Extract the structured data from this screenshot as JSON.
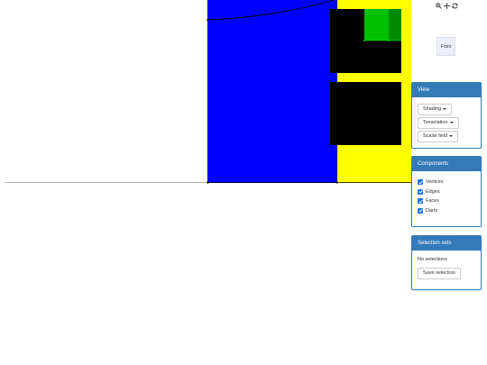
{
  "toolbar": {
    "icons": [
      "zoom-in-icon",
      "move-icon",
      "refresh-icon"
    ]
  },
  "view_cube": {
    "label": "Front"
  },
  "view_panel": {
    "title": "View",
    "buttons": [
      "Shading",
      "Tesselation",
      "Scalar field"
    ]
  },
  "components_panel": {
    "title": "Components",
    "items": [
      {
        "label": "Vertices",
        "checked": true
      },
      {
        "label": "Edges",
        "checked": true
      },
      {
        "label": "Faces",
        "checked": true
      },
      {
        "label": "Darts",
        "checked": true
      }
    ]
  },
  "selection_panel": {
    "title": "Selection sets",
    "empty_text": "No selections",
    "save_label": "Save selection"
  },
  "colors": {
    "blue_face": "#0000ff",
    "yellow_face": "#ffff00",
    "black_face": "#000000",
    "green_face": "#00c000",
    "dark_green_face": "#008a00",
    "accent": "#337ab7",
    "checkbox": "#1a73e8"
  }
}
